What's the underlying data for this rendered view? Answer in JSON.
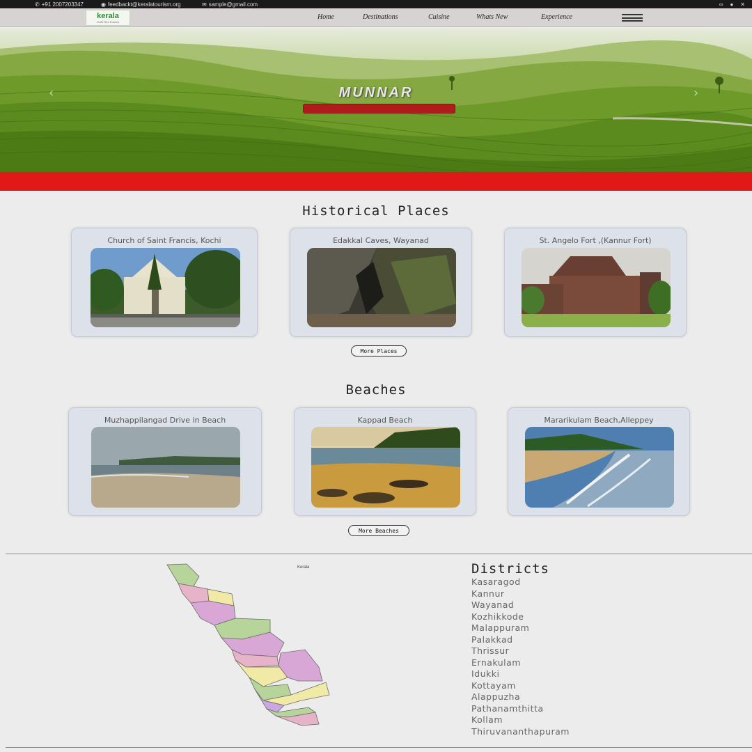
{
  "topbar": {
    "phone": "+91 2007203347",
    "email_feedback": "feedbackt@keralatourism.org",
    "email_sample": "sample@gmail.com"
  },
  "nav": {
    "logo_word": "kerala",
    "logo_tag": "God's Own Country",
    "links": [
      "Home",
      "Destinations",
      "Cuisine",
      "Whats New",
      "Experience"
    ]
  },
  "hero": {
    "title": "MUNNAR"
  },
  "historical": {
    "title": "Historical Places",
    "cards": [
      {
        "title": "Church of Saint Francis, Kochi"
      },
      {
        "title": "Edakkal Caves, Wayanad"
      },
      {
        "title": "St. Angelo Fort ,(Kannur Fort)"
      }
    ],
    "more_label": "More Places"
  },
  "beaches": {
    "title": "Beaches",
    "cards": [
      {
        "title": "Muzhappilangad Drive in Beach"
      },
      {
        "title": "Kappad Beach"
      },
      {
        "title": "Mararikulam Beach,Alleppey"
      }
    ],
    "more_label": "More Beaches"
  },
  "map": {
    "label": "Kerala"
  },
  "districts": {
    "title": "Districts",
    "items": [
      "Kasaragod",
      "Kannur",
      "Wayanad",
      "Kozhikkode",
      "Malappuram",
      "Palakkad",
      "Thrissur",
      "Ernakulam",
      "Idukki",
      "Kottayam",
      "Alappuzha",
      "Pathanamthitta",
      "Kollam",
      "Thiruvananthapuram"
    ]
  }
}
